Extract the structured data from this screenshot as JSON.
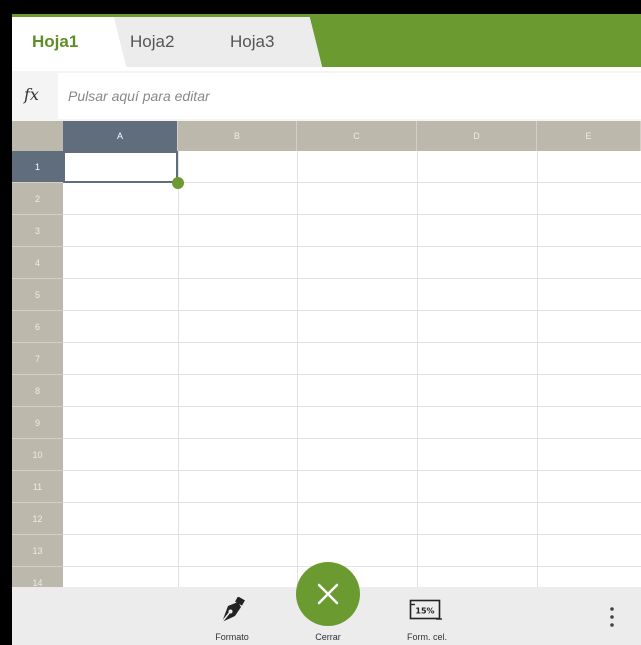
{
  "tabs": [
    {
      "label": "Hoja1",
      "active": true
    },
    {
      "label": "Hoja2",
      "active": false
    },
    {
      "label": "Hoja3",
      "active": false
    }
  ],
  "formula": {
    "icon": "fx",
    "placeholder": "Pulsar aquí para editar"
  },
  "grid": {
    "columns": [
      "A",
      "B",
      "C",
      "D",
      "E"
    ],
    "rows": [
      "1",
      "2",
      "3",
      "4",
      "5",
      "6",
      "7",
      "8",
      "9",
      "10",
      "11",
      "12",
      "13",
      "14"
    ],
    "selected_cell": "A1"
  },
  "toolbar": {
    "format_label": "Formato",
    "close_label": "Cerrar",
    "cell_format_label": "Form. cel.",
    "cell_format_icon_text": "15%"
  },
  "colors": {
    "accent": "#6a9a30",
    "header": "#bdb8ac",
    "header_selected": "#5f6d7d"
  }
}
